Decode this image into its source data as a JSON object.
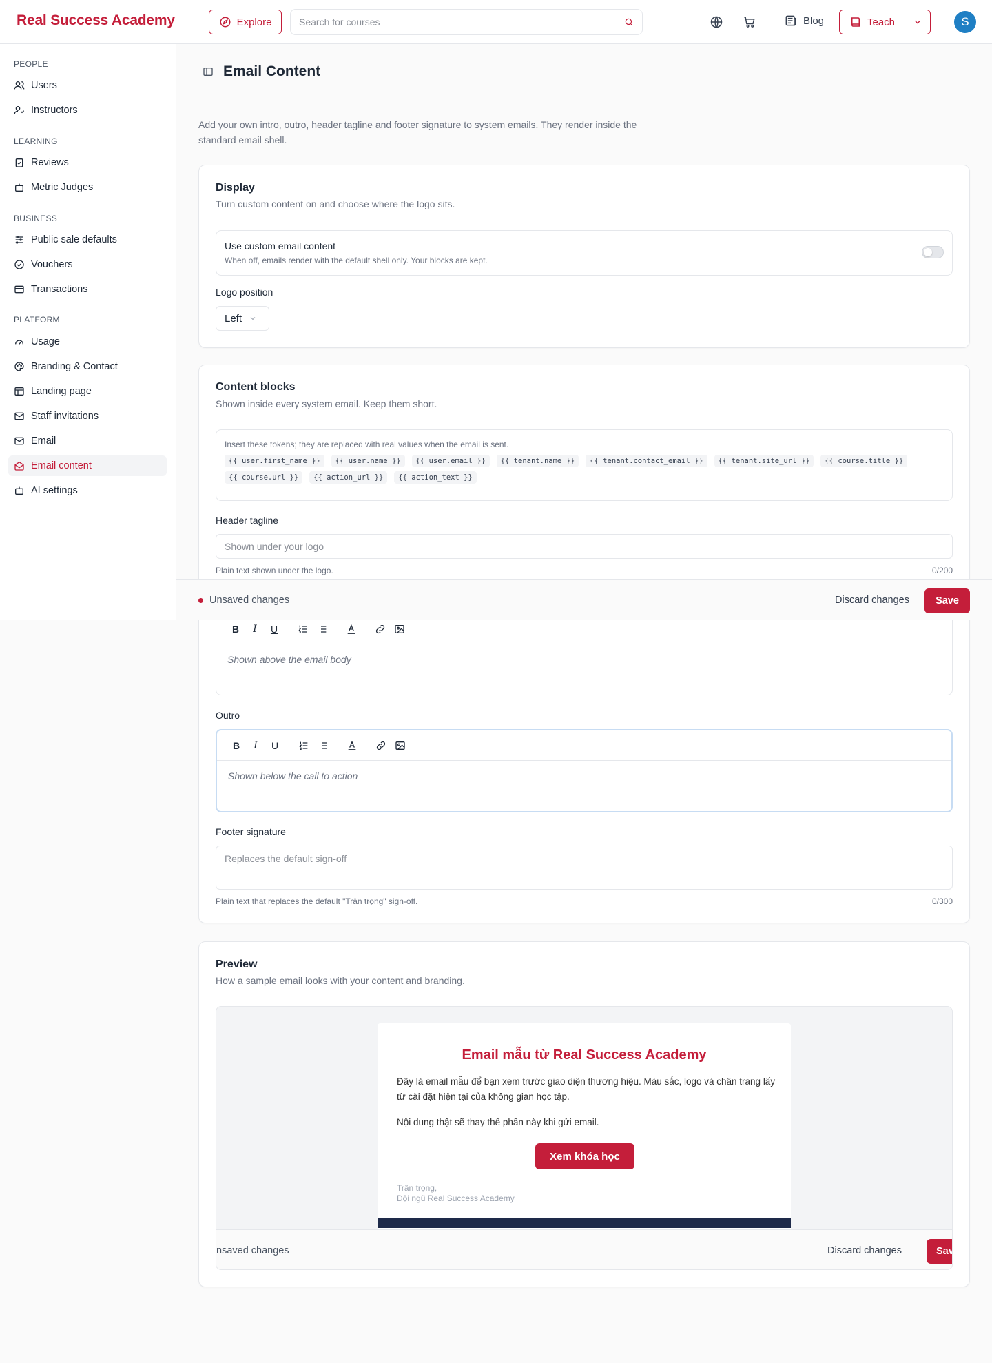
{
  "header": {
    "brand": "Real Success Academy",
    "explore_label": "Explore",
    "search_placeholder": "Search for courses",
    "blog_label": "Blog",
    "teach_label": "Teach",
    "avatar_initial": "S"
  },
  "sidebar": {
    "sections": [
      {
        "title": "PEOPLE",
        "items": [
          {
            "label": "Users",
            "icon": "users-icon"
          },
          {
            "label": "Instructors",
            "icon": "instructor-icon"
          }
        ]
      },
      {
        "title": "LEARNING",
        "items": [
          {
            "label": "Reviews",
            "icon": "clipboard-check-icon"
          },
          {
            "label": "Metric Judges",
            "icon": "bot-icon"
          }
        ]
      },
      {
        "title": "BUSINESS",
        "items": [
          {
            "label": "Public sale defaults",
            "icon": "sliders-icon"
          },
          {
            "label": "Vouchers",
            "icon": "badge-check-icon"
          },
          {
            "label": "Transactions",
            "icon": "wallet-icon"
          }
        ]
      },
      {
        "title": "PLATFORM",
        "items": [
          {
            "label": "Usage",
            "icon": "gauge-icon"
          },
          {
            "label": "Branding & Contact",
            "icon": "palette-icon"
          },
          {
            "label": "Landing page",
            "icon": "layout-icon"
          },
          {
            "label": "Staff invitations",
            "icon": "mail-plus-icon"
          },
          {
            "label": "Email",
            "icon": "mail-icon"
          },
          {
            "label": "Email content",
            "icon": "mail-open-icon",
            "active": true
          },
          {
            "label": "AI settings",
            "icon": "bot-icon"
          }
        ]
      }
    ]
  },
  "page": {
    "title": "Email Content",
    "intro": "Add your own intro, outro, header tagline and footer signature to system emails. They render inside the standard email shell."
  },
  "display": {
    "title": "Display",
    "subtitle": "Turn custom content on and choose where the logo sits.",
    "toggle_label": "Use custom email content",
    "toggle_help": "When off, emails render with the default shell only. Your blocks are kept.",
    "toggle_on": false,
    "logo_label": "Logo position",
    "logo_value": "Left"
  },
  "content": {
    "title": "Content blocks",
    "subtitle": "Shown inside every system email. Keep them short.",
    "tokens_hint": "Insert these tokens; they are replaced with real values when the email is sent.",
    "tokens": [
      "{{ user.first_name }}",
      "{{ user.name }}",
      "{{ user.email }}",
      "{{ tenant.name }}",
      "{{ tenant.contact_email }}",
      "{{ tenant.site_url }}",
      "{{ course.title }}",
      "{{ course.url }}",
      "{{ action_url }}",
      "{{ action_text }}"
    ],
    "header_label": "Header tagline",
    "header_placeholder": "Shown under your logo",
    "header_help": "Plain text shown under the logo.",
    "header_count": "0/200",
    "intro_placeholder": "Shown above the email body",
    "outro_label": "Outro",
    "outro_placeholder": "Shown below the call to action",
    "footer_label": "Footer signature",
    "footer_placeholder": "Replaces the default sign-off",
    "footer_help": "Plain text that replaces the default \"Trân trọng\" sign-off.",
    "footer_count": "0/300"
  },
  "unsaved": {
    "message": "Unsaved changes",
    "discard": "Discard changes",
    "save": "Save",
    "ghost_message": "nsaved changes",
    "ghost_save": "Sav"
  },
  "preview": {
    "title": "Preview",
    "subtitle": "How a sample email looks with your content and branding.",
    "mail_title": "Email mẫu từ Real Success Academy",
    "mail_p1": "Đây là email mẫu để bạn xem trước giao diện thương hiệu. Màu sắc, logo và chân trang lấy từ cài đặt hiện tại của không gian học tập.",
    "mail_p2": "Nội dung thật sẽ thay thế phần này khi gửi email.",
    "mail_button": "Xem khóa học",
    "sign_line1": "Trân trọng,",
    "sign_line2": "Đội ngũ Real Success Academy"
  },
  "colors": {
    "brand": "#c41e3a",
    "avatar": "#1f7fc4",
    "footer_navy": "#1e2a4a"
  }
}
